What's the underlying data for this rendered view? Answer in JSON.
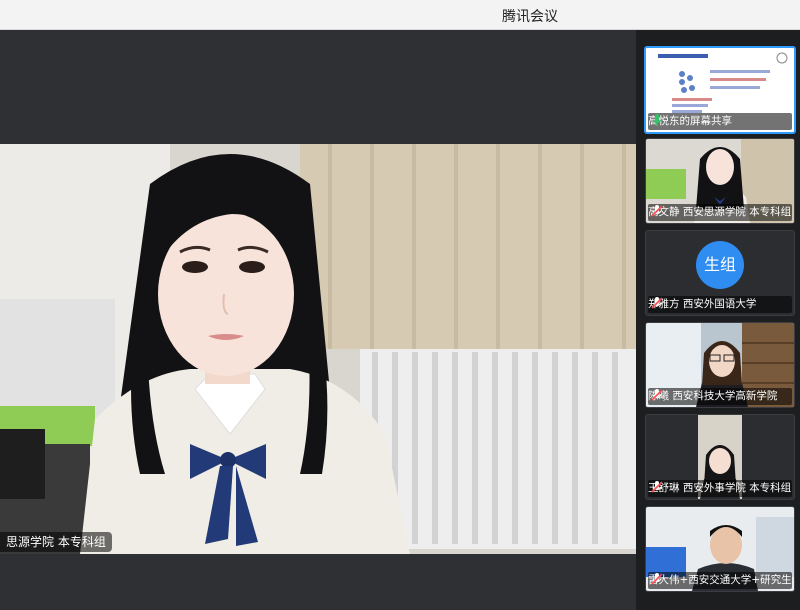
{
  "window": {
    "title": "腾讯会议"
  },
  "main_video": {
    "name_label": "思源学院 本专科组"
  },
  "participants": [
    {
      "label": "高悦东的屏幕共享",
      "type": "screen-share",
      "mic_state": "on"
    },
    {
      "label": "高文静 西安思源学院 本专科组",
      "type": "video",
      "mic_state": "muted"
    },
    {
      "label": "郑雅方 西安外国语大学",
      "type": "avatar",
      "avatar_text": "生组",
      "mic_state": "muted"
    },
    {
      "label": "陈曦 西安科技大学高新学院",
      "type": "video",
      "mic_state": "muted"
    },
    {
      "label": "王舒琳 西安外事学院 本专科组",
      "type": "video",
      "mic_state": "muted"
    },
    {
      "label": "雷大伟+西安交通大学+研究生组",
      "type": "video",
      "mic_state": "muted"
    }
  ],
  "colors": {
    "accent": "#2e9bff",
    "avatar_bg": "#2f8cf0",
    "mic_on": "#35c26b",
    "mic_muted": "#ffffff"
  }
}
